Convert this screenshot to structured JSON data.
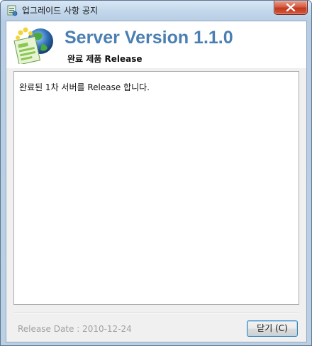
{
  "window": {
    "title": "업그레이드 사항 공지",
    "close_label": "✕"
  },
  "header": {
    "title": "Server Version 1.1.0",
    "subtitle": "완료 제품 Release"
  },
  "content": {
    "text": "완료된 1차 서버를 Release 합니다."
  },
  "footer": {
    "release_date": "Release Date : 2010-12-24",
    "close_button_label": "닫기 (C)"
  },
  "colors": {
    "title_accent": "#4a7fb3",
    "release_date_text": "#a0a0a0"
  },
  "icons": {
    "app": "window-app-icon",
    "logo": "globe-document-logo-icon",
    "close": "close-icon"
  }
}
